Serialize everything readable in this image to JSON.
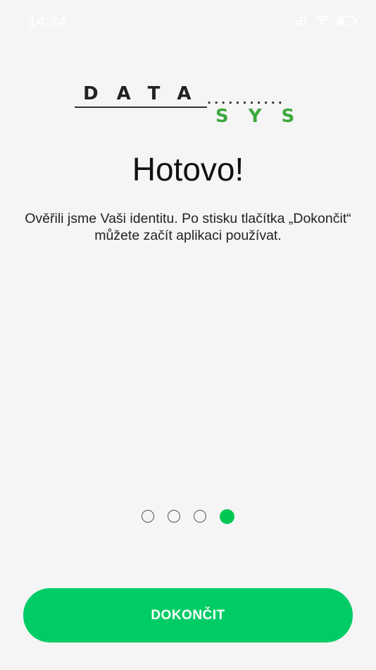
{
  "status_bar": {
    "time": "14:34",
    "icons": [
      "cellular-signal-icon",
      "wifi-icon",
      "battery-icon"
    ]
  },
  "logo": {
    "top_text": "DATA",
    "dots": "...........",
    "bottom_text": "SYS",
    "colors": {
      "top": "#222222",
      "bottom": "#3ea83e"
    }
  },
  "content": {
    "title": "Hotovo!",
    "message": "Ověřili jsme Vaši identitu. Po stisku tlačítka „Dokončit“ můžete začít aplikaci používat."
  },
  "pager": {
    "total": 4,
    "active_index": 3
  },
  "actions": {
    "finish_label": "DOKONČIT"
  },
  "colors": {
    "accent": "#00cc66",
    "background": "#f5f5f5"
  }
}
